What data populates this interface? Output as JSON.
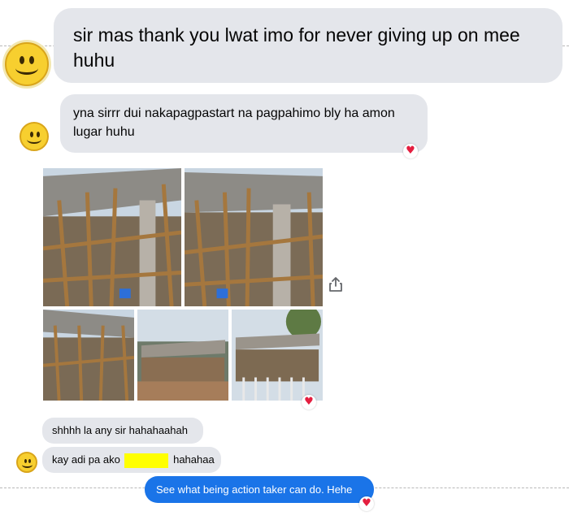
{
  "conversation": {
    "messages": [
      {
        "sender": "them",
        "text": "sir mas thank you lwat imo for never giving up on mee huhu"
      },
      {
        "sender": "them",
        "text": "yna sirrr dui nakapagpastart na pagpahimo bly ha amon lugar huhu",
        "reaction": "heart"
      },
      {
        "sender": "them",
        "type": "photo_album",
        "photo_count": 5,
        "reaction": "heart"
      },
      {
        "sender": "them",
        "text": "shhhh la any sir hahahaahah"
      },
      {
        "sender": "them",
        "text_before": "kay adi pa ako",
        "redacted": true,
        "text_after": "hahahaa"
      },
      {
        "sender": "me",
        "text": "See what being action taker can do. Hehe",
        "reaction": "heart"
      }
    ]
  },
  "icons": {
    "avatar": "smiley-face-icon",
    "reaction": "heart-icon",
    "share": "share-icon"
  },
  "colors": {
    "incoming_bubble": "#e4e6eb",
    "outgoing_bubble": "#1a74e8",
    "reaction_heart": "#e41e3f",
    "redaction": "#ffff00"
  }
}
